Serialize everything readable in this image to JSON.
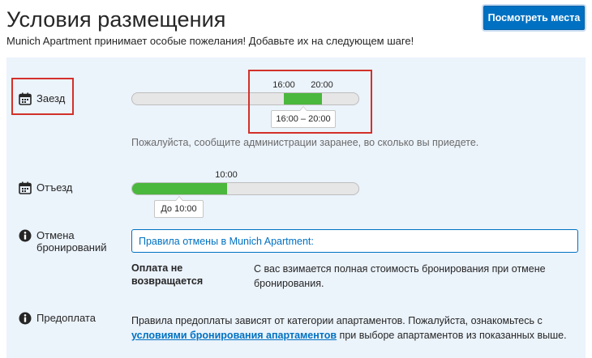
{
  "header": {
    "title": "Условия размещения",
    "subtitle": "Munich Apartment принимает особые пожелания! Добавьте их на следующем шаге!",
    "cta_label": "Посмотреть места"
  },
  "checkin": {
    "label": "Заезд",
    "icon": "calendar-icon",
    "start_label": "16:00",
    "end_label": "20:00",
    "range_label": "16:00 – 20:00",
    "note": "Пожалуйста, сообщите администрации заранее, во сколько вы приедете."
  },
  "checkout": {
    "label": "Отъезд",
    "icon": "calendar-icon",
    "time_label": "10:00",
    "range_label": "До 10:00"
  },
  "cancellation": {
    "label": "Отмена бронирований",
    "icon": "info-icon",
    "box_text": "Правила отмены в Munich Apartment:",
    "term": "Оплата не возвращается",
    "description": "С вас взимается полная стоимость бронирования при отмене бронирования."
  },
  "prepayment": {
    "label": "Предоплата",
    "icon": "info-icon",
    "text_before": "Правила предоплаты зависят от категории апартаментов. Пожалуйста, ознакомьтесь с ",
    "link_text": "условиями бронирования апартаментов",
    "text_after": " при выборе апартаментов из показанных выше."
  },
  "colors": {
    "accent": "#0071c2",
    "bar_fill": "#4ab73d",
    "panel_bg": "#ebf3fb",
    "highlight": "#d3312a"
  }
}
